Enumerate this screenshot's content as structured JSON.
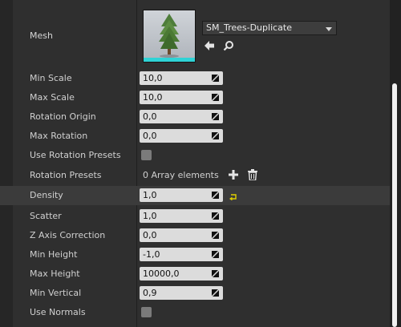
{
  "mesh": {
    "label": "Mesh",
    "asset_name": "SM_Trees-Duplicate",
    "thumbnail": "tree-thumbnail",
    "base_color": "#2fd3d6"
  },
  "rows": {
    "min_scale": {
      "label": "Min Scale",
      "value": "10,0"
    },
    "max_scale": {
      "label": "Max Scale",
      "value": "10,0"
    },
    "rotation_origin": {
      "label": "Rotation Origin",
      "value": "0,0"
    },
    "max_rotation": {
      "label": "Max Rotation",
      "value": "0,0"
    },
    "use_rotation_presets": {
      "label": "Use Rotation Presets",
      "checked": false
    },
    "rotation_presets": {
      "label": "Rotation Presets",
      "value": "0 Array elements"
    },
    "density": {
      "label": "Density",
      "value": "1,0"
    },
    "scatter": {
      "label": "Scatter",
      "value": "1,0"
    },
    "z_axis_correction": {
      "label": "Z Axis Correction",
      "value": "0,0"
    },
    "min_height": {
      "label": "Min Height",
      "value": "-1,0"
    },
    "max_height": {
      "label": "Max Height",
      "value": "10000,0"
    },
    "min_vertical": {
      "label": "Min Vertical",
      "value": "0,9"
    },
    "use_normals": {
      "label": "Use Normals",
      "checked": false
    }
  },
  "colors": {
    "panel_bg": "#2f2f2f",
    "highlight_row": "#3b3b3b",
    "field_bg": "#dcdcdc",
    "reset_icon": "#e0d000"
  }
}
